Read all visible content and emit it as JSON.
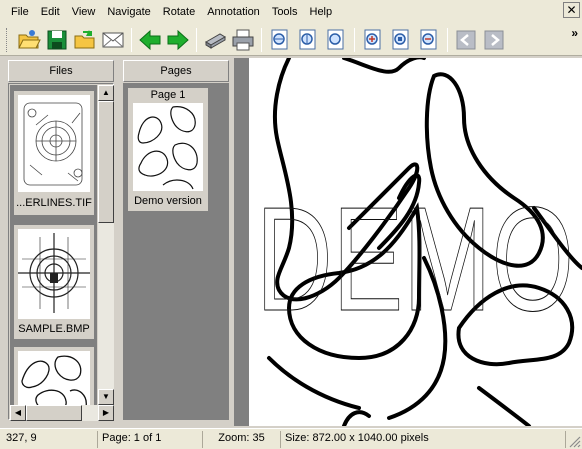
{
  "menu": {
    "items": [
      "File",
      "Edit",
      "View",
      "Navigate",
      "Rotate",
      "Annotation",
      "Tools",
      "Help"
    ],
    "close_glyph": "✕"
  },
  "toolbar": {
    "icons": [
      "open-folder-icon",
      "save-icon",
      "open-next-icon",
      "email-icon",
      "back-arrow-icon",
      "forward-arrow-icon",
      "scanner-icon",
      "print-icon",
      "fit-width-icon",
      "fit-height-icon",
      "fit-page-icon",
      "zoom-in-icon",
      "zoom-actual-icon",
      "zoom-out-icon",
      "rotate-left-icon",
      "rotate-right-icon"
    ],
    "overflow_glyph": "»",
    "colors": {
      "arrow_green": "#1fae2e",
      "save_green": "#1a8f3a"
    }
  },
  "files_panel": {
    "title": "Files",
    "items": [
      {
        "label": "...ERLINES.TIF"
      },
      {
        "label": "SAMPLE.BMP"
      },
      {
        "label": ""
      }
    ]
  },
  "pages_panel": {
    "title": "Pages",
    "items": [
      {
        "title": "Page 1",
        "label": "Demo version"
      }
    ]
  },
  "viewer": {
    "watermark": "DEMO"
  },
  "status": {
    "coords": "327, 9",
    "page": "Page: 1 of 1",
    "zoom": "Zoom: 35",
    "size": "Size: 872.00 x 1040.00 pixels"
  }
}
